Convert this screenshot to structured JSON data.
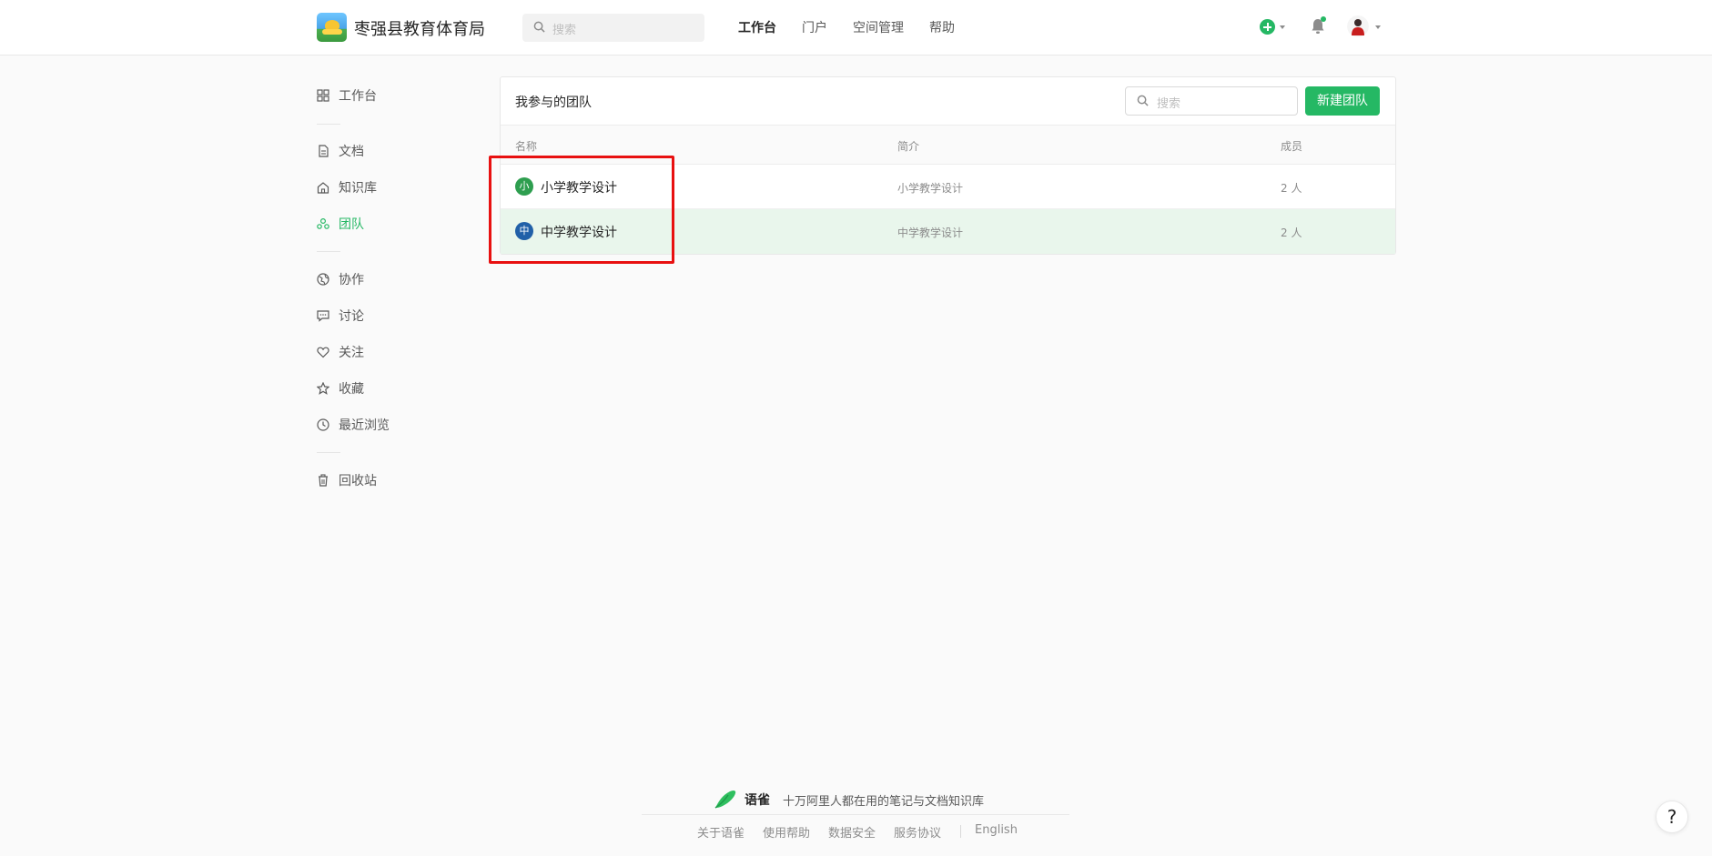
{
  "header": {
    "org_name": "枣强县教育体育局",
    "search_placeholder": "搜索",
    "nav": [
      "工作台",
      "门户",
      "空间管理",
      "帮助"
    ],
    "accent_color": "#25b864"
  },
  "sidebar": {
    "items": [
      {
        "label": "工作台",
        "icon": "dashboard-icon"
      },
      {
        "label": "文档",
        "icon": "document-icon"
      },
      {
        "label": "知识库",
        "icon": "knowledge-base-icon"
      },
      {
        "label": "团队",
        "icon": "team-icon"
      },
      {
        "label": "协作",
        "icon": "globe-icon"
      },
      {
        "label": "讨论",
        "icon": "comment-icon"
      },
      {
        "label": "关注",
        "icon": "heart-icon"
      },
      {
        "label": "收藏",
        "icon": "star-icon"
      },
      {
        "label": "最近浏览",
        "icon": "clock-icon"
      },
      {
        "label": "回收站",
        "icon": "trash-icon"
      }
    ]
  },
  "main": {
    "title": "我参与的团队",
    "search_placeholder": "搜索",
    "new_button": "新建团队",
    "columns": [
      "名称",
      "简介",
      "成员"
    ],
    "rows": [
      {
        "badge": "小",
        "name": "小学教学设计",
        "desc": "小学教学设计",
        "members": "2 人",
        "badge_color": "#2e9e4f"
      },
      {
        "badge": "中",
        "name": "中学教学设计",
        "desc": "中学教学设计",
        "members": "2 人",
        "badge_color": "#2160a8"
      }
    ]
  },
  "footer": {
    "brand": "语雀",
    "slogan": "十万阿里人都在用的笔记与文档知识库",
    "links": [
      "关于语雀",
      "使用帮助",
      "数据安全",
      "服务协议",
      "English"
    ]
  },
  "help_button": "?"
}
